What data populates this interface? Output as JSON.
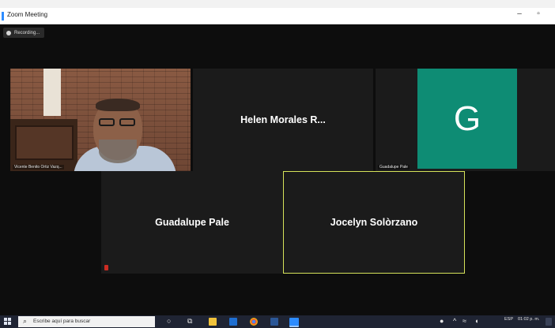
{
  "window": {
    "title": "Zoom Meeting",
    "controls": {
      "minimize": "–",
      "restore": "▫"
    }
  },
  "recording": {
    "label": "Recording..."
  },
  "participants": [
    {
      "id": "vicente",
      "label": "Vicente Benito Ortiz Vazq...",
      "has_video": true
    },
    {
      "id": "helen",
      "label": "Helen Morales R..."
    },
    {
      "id": "guadalupe-top",
      "label": "Guadalupe Pale",
      "avatar_letter": "G",
      "avatar_color": "#0e8c74"
    },
    {
      "id": "guadalupe",
      "label": "Guadalupe Pale",
      "muted": true
    },
    {
      "id": "jocelyn",
      "label": "Jocelyn Solòrzano",
      "active_speaker": true,
      "speaker_color": "#d6e35a"
    }
  ],
  "taskbar": {
    "search_placeholder": "Escribe aquí para buscar",
    "icons": [
      "search-icon",
      "task-view-icon",
      "file-explorer-icon",
      "outlook-icon",
      "chrome-icon",
      "word-icon",
      "zoom-icon"
    ],
    "tray": {
      "language": "ESP",
      "time": "01:02 p. m."
    }
  },
  "colors": {
    "accent": "#2d8cff",
    "speaker_border": "#d6e35a",
    "avatar": "#0e8c74",
    "mute": "#cc2c23"
  }
}
